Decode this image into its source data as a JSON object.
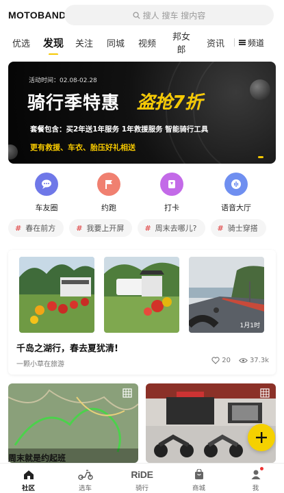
{
  "app": {
    "logo": "MOTOBAND"
  },
  "search": {
    "placeholder": "搜人 搜车 搜内容"
  },
  "tabs": [
    {
      "label": "优选"
    },
    {
      "label": "发现"
    },
    {
      "label": "关注"
    },
    {
      "label": "同城"
    },
    {
      "label": "视频"
    },
    {
      "label": "邦女郎"
    },
    {
      "label": "资讯"
    }
  ],
  "channel_label": "频道",
  "banner": {
    "date": "活动时间：02.08-02.28",
    "title": "骑行季特惠",
    "highlight": "盗抢7折",
    "line1": "套餐包含：买2年送1年服务 1年救援服务 智能骑行工具",
    "line2": "更有救援、车衣、胎压好礼相送"
  },
  "quick": [
    {
      "label": "车友圈",
      "color": "#6f78e8"
    },
    {
      "label": "约跑",
      "color": "#f08070"
    },
    {
      "label": "打卡",
      "color": "#c36ae8"
    },
    {
      "label": "语音大厅",
      "color": "#6f8ff0"
    }
  ],
  "chips": [
    {
      "label": "春在前方"
    },
    {
      "label": "我要上开屏"
    },
    {
      "label": "周末去哪儿?"
    },
    {
      "label": "骑士穿搭"
    }
  ],
  "post": {
    "title": "千岛之湖行，春去夏犹清!",
    "author": "一颗小草在旅游",
    "likes": "20",
    "views": "37.3k",
    "photo_badge": "1月1时"
  },
  "lower": {
    "title_left": "周末就是约起班"
  },
  "nav": [
    {
      "label": "社区"
    },
    {
      "label": "选车"
    },
    {
      "label": "骑行"
    },
    {
      "label": "商城"
    },
    {
      "label": "我"
    }
  ],
  "nav_ride_logo": "RiDE",
  "colors": {
    "accent": "#f5c800",
    "chip_hash": "#e25a5a"
  }
}
